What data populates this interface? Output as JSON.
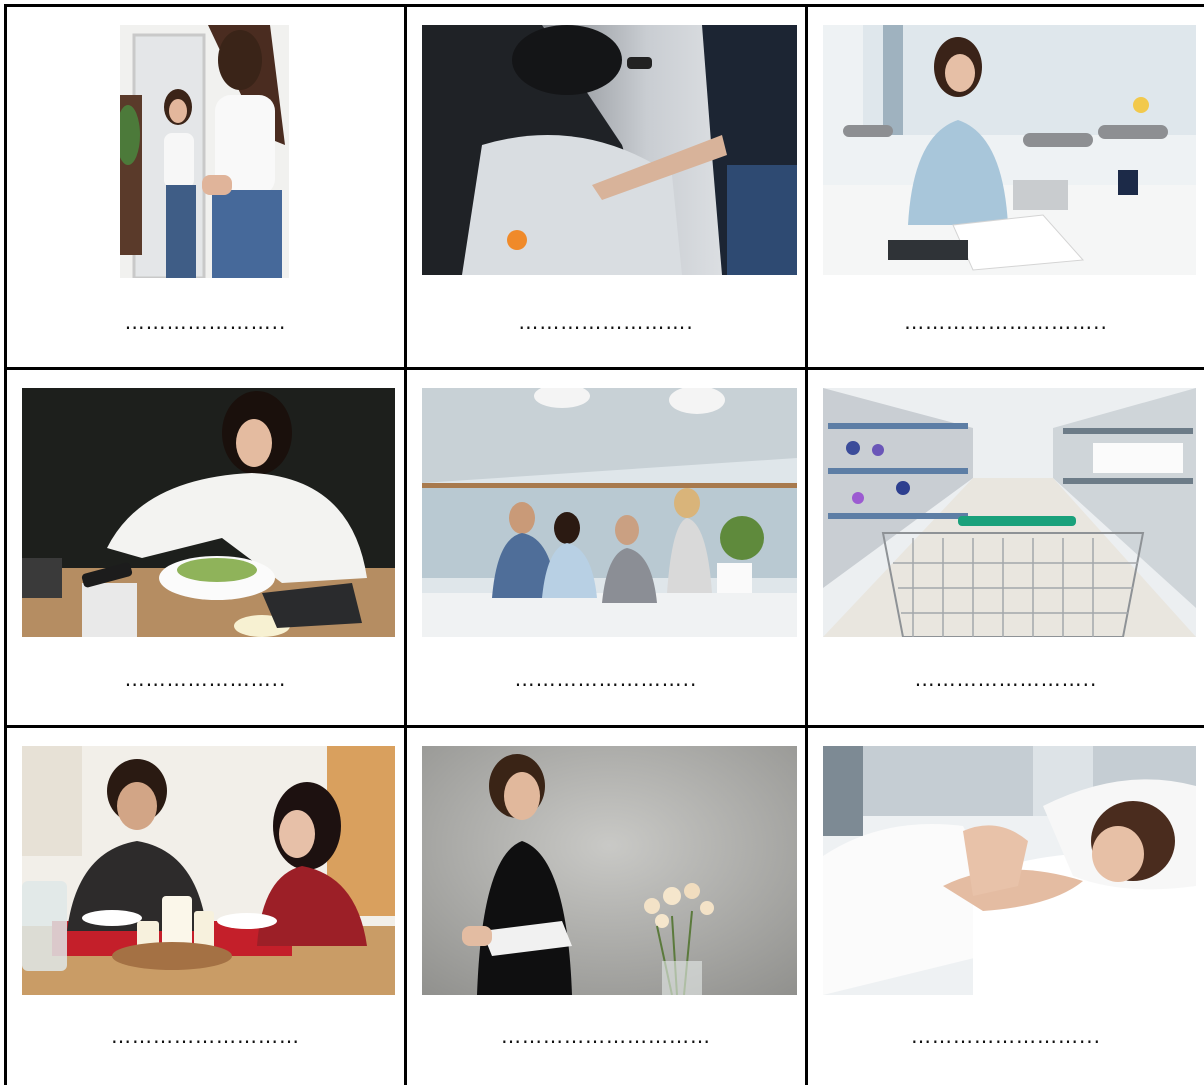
{
  "worksheet": {
    "cells": [
      {
        "picture": "woman-trying-on-jeans-mirror-photo",
        "blank": "………………….."
      },
      {
        "picture": "person-unlocking-car-photo",
        "blank": "……………………."
      },
      {
        "picture": "woman-working-at-office-desk-photo",
        "blank": "……………………….."
      },
      {
        "picture": "woman-eating-salad-photo",
        "blank": "………………….."
      },
      {
        "picture": "team-meeting-office-photo",
        "blank": "…………………….."
      },
      {
        "picture": "supermarket-shopping-cart-photo",
        "blank": "…………………….."
      },
      {
        "picture": "couple-dinner-candles-photo",
        "blank": "………………………"
      },
      {
        "picture": "woman-reading-book-photo",
        "blank": "…………………………"
      },
      {
        "picture": "woman-sleeping-in-bed-photo",
        "blank": "……………………..."
      }
    ]
  }
}
